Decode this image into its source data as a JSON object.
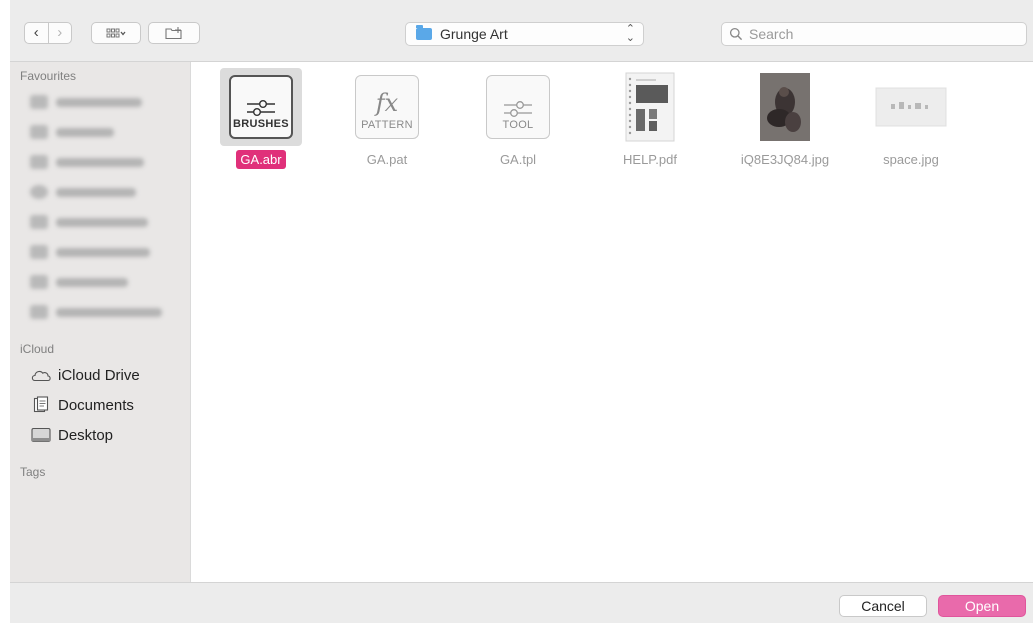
{
  "toolbar": {
    "back_glyph": "‹",
    "forward_glyph": "›",
    "location": "Grunge Art",
    "search_placeholder": "Search"
  },
  "sidebar": {
    "favourites_heading": "Favourites",
    "icloud_heading": "iCloud",
    "icloud_items": [
      {
        "label": "iCloud Drive",
        "icon": "cloud-icon"
      },
      {
        "label": "Documents",
        "icon": "documents-icon"
      },
      {
        "label": "Desktop",
        "icon": "desktop-icon"
      }
    ],
    "tags_heading": "Tags"
  },
  "files": [
    {
      "name": "GA.abr",
      "type": "doc",
      "label": "BRUSHES",
      "glyph": "sliders",
      "selected": true
    },
    {
      "name": "GA.pat",
      "type": "doc",
      "label": "PATTERN",
      "glyph": "fx",
      "selected": false
    },
    {
      "name": "GA.tpl",
      "type": "doc",
      "label": "TOOL",
      "glyph": "sliders",
      "selected": false
    },
    {
      "name": "HELP.pdf",
      "type": "pdf",
      "selected": false
    },
    {
      "name": "iQ8E3JQ84.jpg",
      "type": "photo",
      "selected": false
    },
    {
      "name": "space.jpg",
      "type": "image",
      "selected": false
    }
  ],
  "fx_glyph": "fx",
  "buttons": {
    "cancel": "Cancel",
    "open": "Open"
  },
  "colors": {
    "accent": "#e0307a",
    "open_button": "#e96aab",
    "folder": "#5aa8e8"
  }
}
